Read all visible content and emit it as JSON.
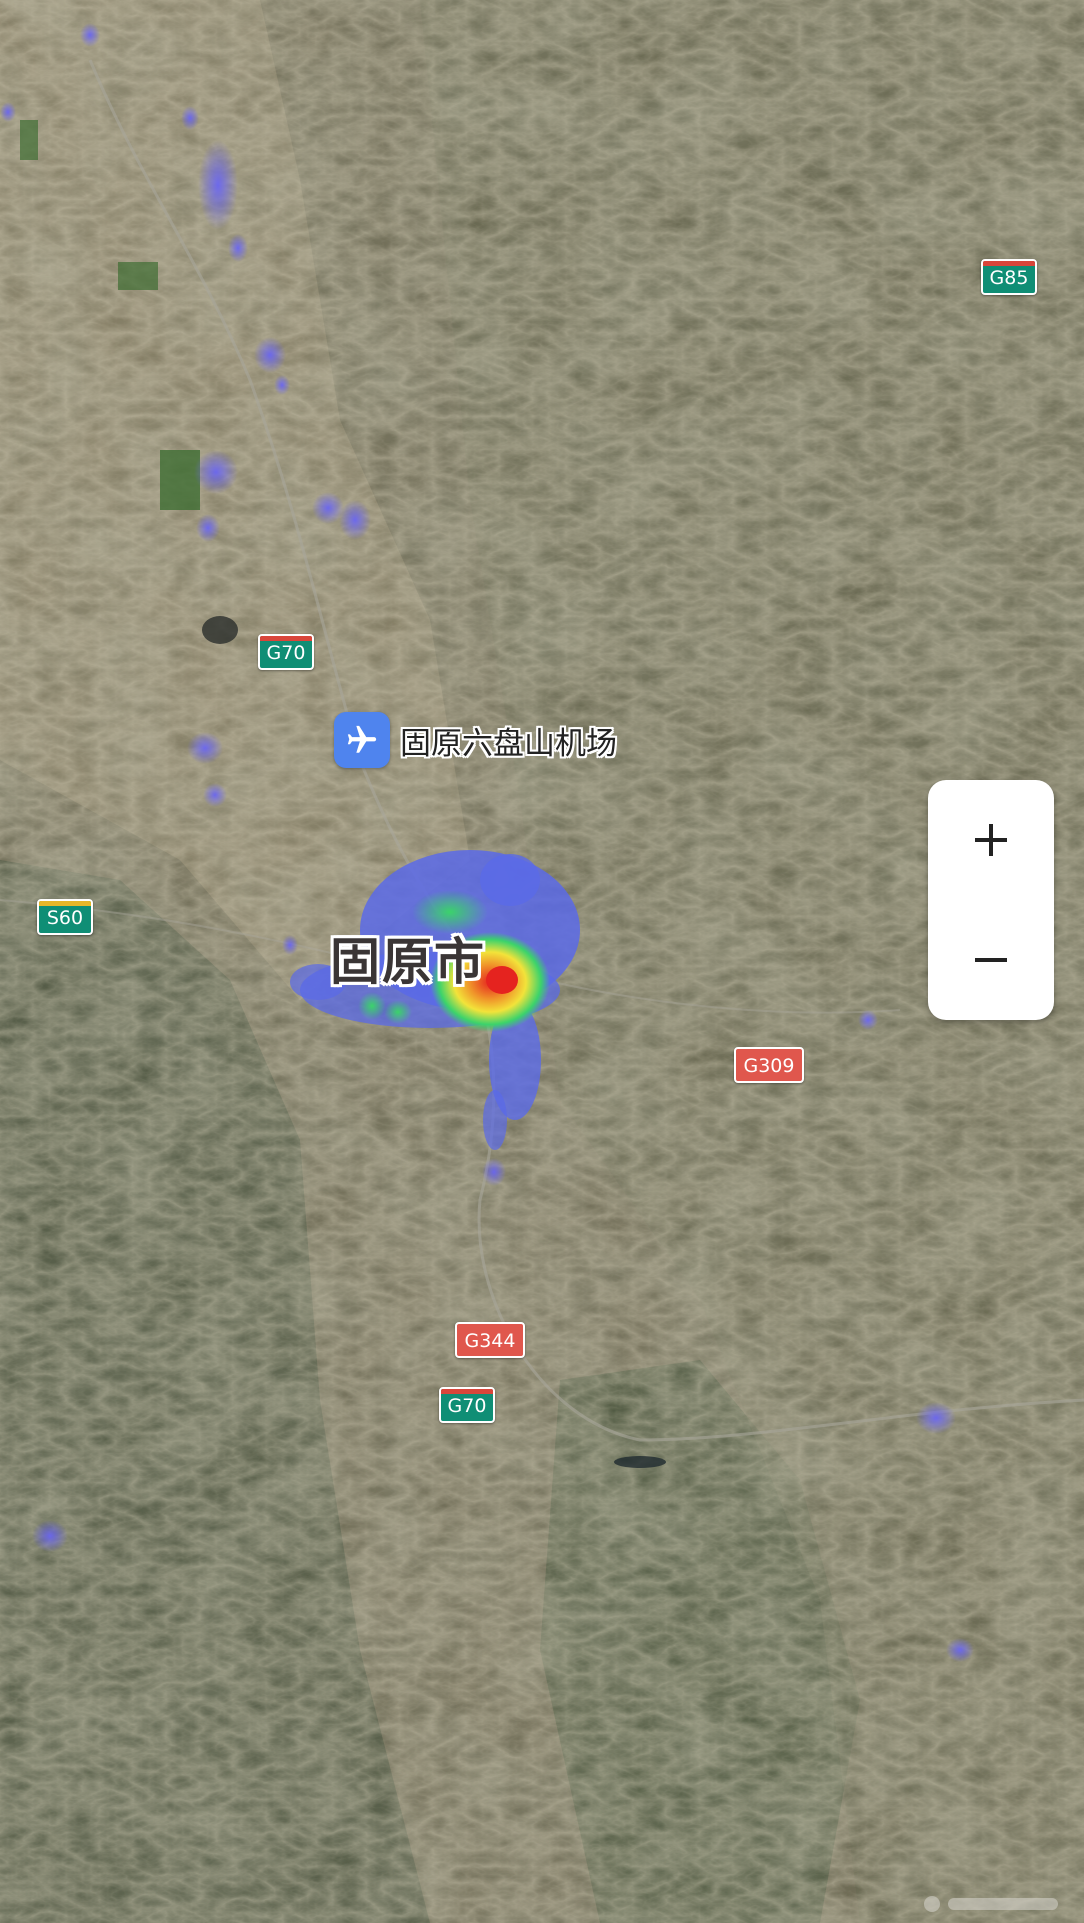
{
  "map": {
    "type": "satellite",
    "overlay": "heatmap",
    "colors": {
      "heat_low": "#5a6ae8",
      "heat_mid": "#3bd36b",
      "heat_high": "#f2e33a",
      "heat_peak": "#e5231f"
    }
  },
  "labels": {
    "city": "固原市",
    "airport": "固原六盘山机场"
  },
  "highway_shields": [
    {
      "id": "g85",
      "label": "G85",
      "style": "national"
    },
    {
      "id": "g70-north",
      "label": "G70",
      "style": "national"
    },
    {
      "id": "s60",
      "label": "S60",
      "style": "provincial"
    },
    {
      "id": "g309",
      "label": "G309",
      "style": "route"
    },
    {
      "id": "g344",
      "label": "G344",
      "style": "route"
    },
    {
      "id": "g70-south",
      "label": "G70",
      "style": "national"
    }
  ],
  "icons": {
    "airport": "airplane-icon",
    "zoom_in": "plus-icon",
    "zoom_out": "minus-icon"
  },
  "controls": {
    "zoom_in": "+",
    "zoom_out": "−"
  }
}
